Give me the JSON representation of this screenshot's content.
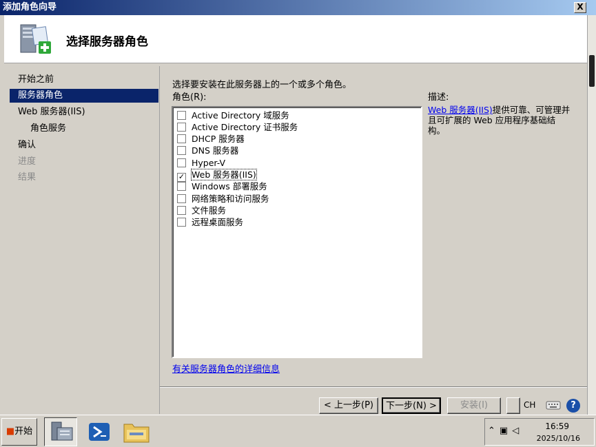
{
  "window": {
    "title": "添加角色向导",
    "close_symbol": "X"
  },
  "header": {
    "title": "选择服务器角色",
    "icon": "server-add-icon"
  },
  "nav": {
    "items": [
      {
        "label": "开始之前",
        "state": "normal"
      },
      {
        "label": "服务器角色",
        "state": "selected"
      },
      {
        "label": "Web 服务器(IIS)",
        "state": "normal"
      },
      {
        "label": "角色服务",
        "state": "sub"
      },
      {
        "label": "确认",
        "state": "normal"
      },
      {
        "label": "进度",
        "state": "disabled"
      },
      {
        "label": "结果",
        "state": "disabled"
      }
    ]
  },
  "main": {
    "instruction": "选择要安装在此服务器上的一个或多个角色。",
    "roles_label": "角色(R):",
    "roles": [
      {
        "label": "Active Directory 域服务",
        "checked": false
      },
      {
        "label": "Active Directory 证书服务",
        "checked": false
      },
      {
        "label": "DHCP 服务器",
        "checked": false
      },
      {
        "label": "DNS 服务器",
        "checked": false
      },
      {
        "label": "Hyper-V",
        "checked": false
      },
      {
        "label": "Web 服务器(IIS)",
        "checked": true
      },
      {
        "label": "Windows 部署服务",
        "checked": false
      },
      {
        "label": "网络策略和访问服务",
        "checked": false
      },
      {
        "label": "文件服务",
        "checked": false
      },
      {
        "label": "远程桌面服务",
        "checked": false
      }
    ],
    "more_info_link": "有关服务器角色的详细信息",
    "description_title": "描述:",
    "description_link": "Web 服务器(IIS)",
    "description_text": "提供可靠、可管理并且可扩展的 Web 应用程序基础结构。"
  },
  "buttons": {
    "back": "< 上一步(P)",
    "next": "下一步(N) >",
    "install": "安装(I)"
  },
  "langbar": {
    "lang": "CH"
  },
  "taskbar": {
    "start": "开始",
    "time": "16:59",
    "date": "2025/10/16"
  },
  "colors": {
    "selection": "#0a246a",
    "link": "#0000ee",
    "face": "#d4d0c8"
  }
}
